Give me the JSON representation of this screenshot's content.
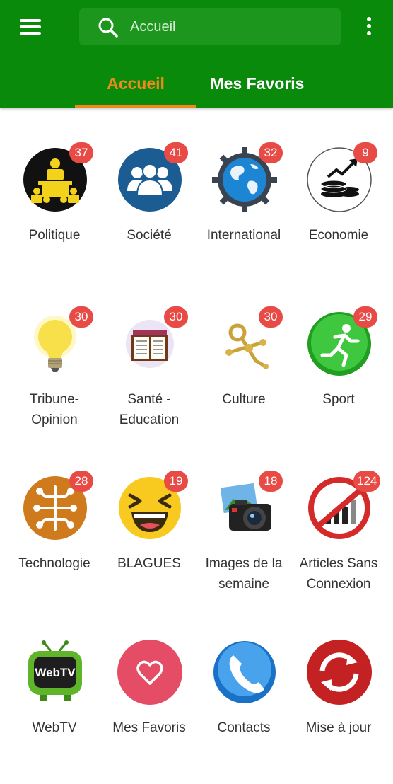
{
  "appbar": {
    "search_placeholder": "Accueil",
    "tabs": [
      {
        "label": "Accueil",
        "active": true
      },
      {
        "label": "Mes Favoris",
        "active": false
      }
    ],
    "colors": {
      "primary": "#0a8a0a",
      "accent": "#ef8a1a",
      "badge": "#e84a45"
    }
  },
  "categories": [
    {
      "label": "Politique",
      "count": "37",
      "icon": "politics-icon"
    },
    {
      "label": "Société",
      "count": "41",
      "icon": "society-icon"
    },
    {
      "label": "International",
      "count": "32",
      "icon": "globe-gear-icon"
    },
    {
      "label": "Economie",
      "count": "9",
      "icon": "coins-chart-icon"
    },
    {
      "label": "Tribune-Opinion",
      "count": "30",
      "icon": "lightbulb-icon"
    },
    {
      "label": "Santé - Education",
      "count": "30",
      "icon": "book-icon"
    },
    {
      "label": "Culture",
      "count": "30",
      "icon": "agadez-cross-icon"
    },
    {
      "label": "Sport",
      "count": "29",
      "icon": "runner-icon"
    },
    {
      "label": "Technologie",
      "count": "28",
      "icon": "circuit-icon"
    },
    {
      "label": "BLAGUES",
      "count": "19",
      "icon": "laughing-emoji-icon"
    },
    {
      "label": "Images de la semaine",
      "count": "18",
      "icon": "camera-icon"
    },
    {
      "label": "Articles Sans Connexion",
      "count": "124",
      "icon": "no-signal-icon"
    },
    {
      "label": "WebTV",
      "count": "",
      "icon": "webtv-icon"
    },
    {
      "label": "Mes Favoris",
      "count": "",
      "icon": "heart-icon"
    },
    {
      "label": "Contacts",
      "count": "",
      "icon": "phone-icon"
    },
    {
      "label": "Mise à jour",
      "count": "",
      "icon": "refresh-icon"
    }
  ]
}
